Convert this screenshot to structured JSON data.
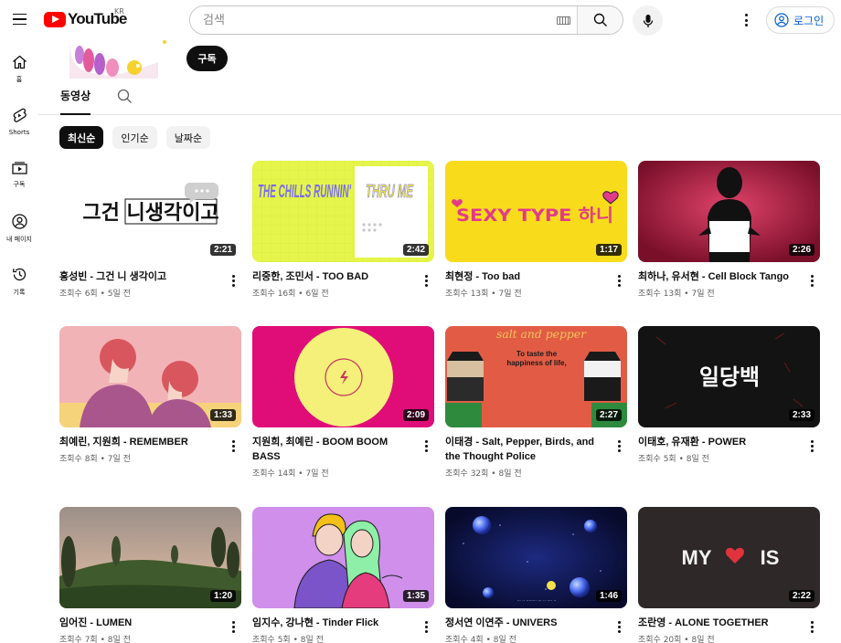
{
  "header": {
    "logo_text": "YouTube",
    "region": "KR",
    "search_placeholder": "검색",
    "login_label": "로그인"
  },
  "sidebar": {
    "items": [
      {
        "label": "홈",
        "icon": "home-icon"
      },
      {
        "label": "Shorts",
        "icon": "shorts-icon"
      },
      {
        "label": "구독",
        "icon": "subscriptions-icon"
      },
      {
        "label": "내 페이지",
        "icon": "you-icon"
      },
      {
        "label": "기록",
        "icon": "history-icon"
      }
    ]
  },
  "channel": {
    "subscribe_label": "구독",
    "tab_videos": "동영상"
  },
  "chips": [
    "최신순",
    "인기순",
    "날짜순"
  ],
  "videos": [
    {
      "title": "홍성빈 - 그건 니 생각이고",
      "meta": "조회수 6회 • 5일 전",
      "duration": "2:21",
      "thumb_text": "그건 니생각이고"
    },
    {
      "title": "리중한, 조민서 - TOO BAD",
      "meta": "조회수 16회 • 6일 전",
      "duration": "2:42",
      "thumb_text": "THE CHILLS RUNNIN'",
      "thumb_text2": "THRU ME"
    },
    {
      "title": "최현정 - Too bad",
      "meta": "조회수 13회 • 7일 전",
      "duration": "1:17",
      "thumb_text": "SEXY TYPE 하니"
    },
    {
      "title": "최하나, 유서현 - Cell Block Tango",
      "meta": "조회수 13회 • 7일 전",
      "duration": "2:26"
    },
    {
      "title": "최예린, 지원희 - REMEMBER",
      "meta": "조회수 8회 • 7일 전",
      "duration": "1:33"
    },
    {
      "title": "지원희, 최예린 - BOOM BOOM BASS",
      "meta": "조회수 14회 • 7일 전",
      "duration": "2:09"
    },
    {
      "title": "이태경 - Salt, Pepper, Birds, and the Thought Police",
      "meta": "조회수 32회 • 8일 전",
      "duration": "2:27",
      "thumb_text": "salt and pepper",
      "thumb_text2": "To taste the happiness of life,"
    },
    {
      "title": "이태호, 유재환 - POWER",
      "meta": "조회수 5회 • 8일 전",
      "duration": "2:33",
      "thumb_text": "일당백"
    },
    {
      "title": "임어진 - LUMEN",
      "meta": "조회수 7회 • 8일 전",
      "duration": "1:20"
    },
    {
      "title": "임지수, 강나현 - Tinder Flick",
      "meta": "조회수 5회 • 8일 전",
      "duration": "1:35"
    },
    {
      "title": "정서연 이연주 - UNIVERS",
      "meta": "조회수 4회 • 8일 전",
      "duration": "1:46"
    },
    {
      "title": "조란영 - ALONE TOGETHER",
      "meta": "조회수 20회 • 8일 전",
      "duration": "2:22",
      "thumb_text": "MY",
      "thumb_text2": "IS"
    }
  ]
}
